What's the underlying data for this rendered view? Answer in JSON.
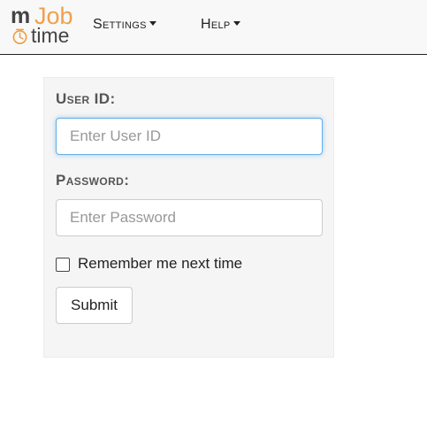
{
  "logo": {
    "m": "m",
    "job": "Job",
    "time": "time"
  },
  "nav": {
    "settings": {
      "label": "Settings"
    },
    "help": {
      "label": "Help"
    }
  },
  "login": {
    "userid_label": "User ID:",
    "userid_placeholder": "Enter User ID",
    "userid_value": "",
    "password_label": "Password:",
    "password_placeholder": "Enter Password",
    "password_value": "",
    "remember_label": "Remember me next time",
    "remember_checked": false,
    "submit_label": "Submit"
  },
  "colors": {
    "brand_orange": "#f0a04b",
    "brand_gray": "#444444",
    "focus_border": "#66afe9",
    "panel_bg": "#f5f5f5"
  },
  "icons": {
    "clock": "clock-icon",
    "caret": "caret-down-icon",
    "checkbox": "checkbox-unchecked"
  }
}
